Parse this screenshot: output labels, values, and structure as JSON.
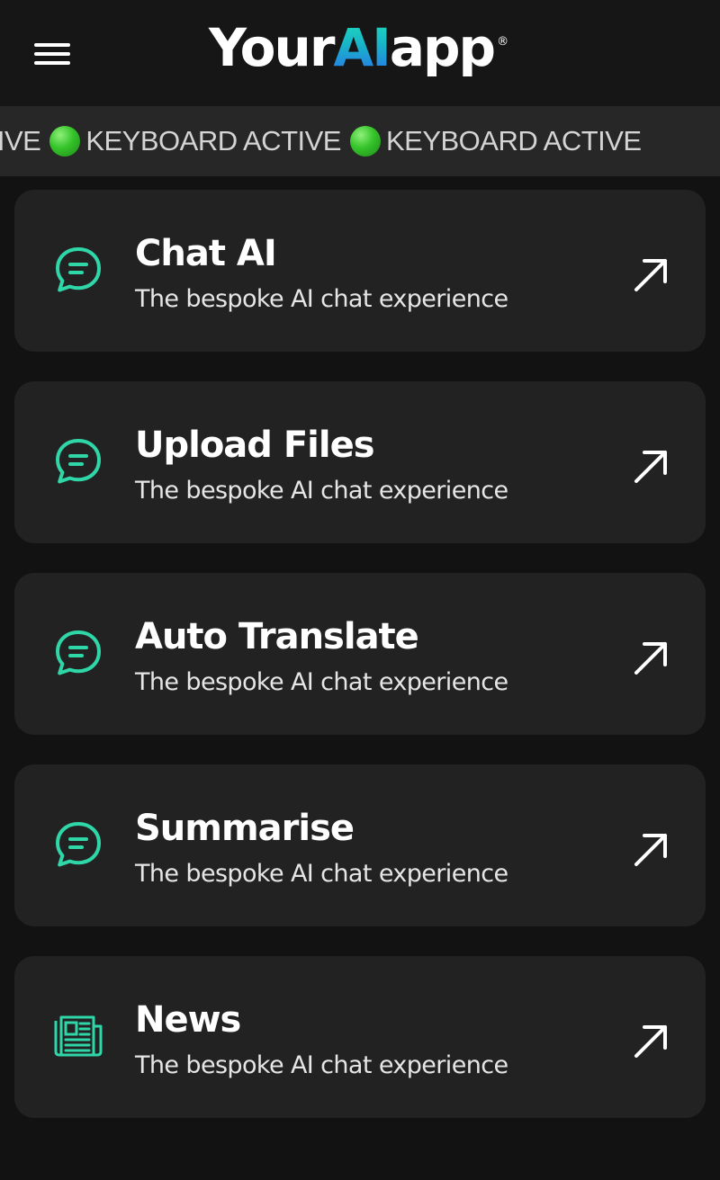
{
  "header": {
    "menu_icon": "hamburger-menu-icon",
    "logo": {
      "part1": "Your",
      "part2": "AI",
      "part3": "app",
      "registered": "®",
      "accent_gradient": [
        "#1fe0b8",
        "#2a6df0"
      ]
    }
  },
  "ticker": {
    "items": [
      {
        "text": "ARD ACTIVE",
        "icon": "green-dot-icon"
      },
      {
        "text": "KEYBOARD ACTIVE",
        "icon": "green-dot-icon"
      },
      {
        "text": "KEYBOARD ACTIVE",
        "icon": "green-dot-icon"
      }
    ],
    "dot_color": "#35c32a"
  },
  "cards": [
    {
      "title": "Chat AI",
      "subtitle": "The bespoke AI chat experience",
      "icon": "chat-bubble-icon",
      "action_icon": "arrow-up-right-icon"
    },
    {
      "title": "Upload Files",
      "subtitle": "The bespoke AI chat experience",
      "icon": "chat-bubble-icon",
      "action_icon": "arrow-up-right-icon"
    },
    {
      "title": "Auto Translate",
      "subtitle": "The bespoke AI chat experience",
      "icon": "chat-bubble-icon",
      "action_icon": "arrow-up-right-icon"
    },
    {
      "title": "Summarise",
      "subtitle": "The bespoke AI chat experience",
      "icon": "chat-bubble-icon",
      "action_icon": "arrow-up-right-icon"
    },
    {
      "title": "News",
      "subtitle": "The bespoke AI chat experience",
      "icon": "newspaper-icon",
      "action_icon": "arrow-up-right-icon"
    }
  ],
  "colors": {
    "background": "#121212",
    "header": "#161616",
    "ticker": "#272727",
    "card": "#222222",
    "icon_accent": "#2fd6a8"
  }
}
